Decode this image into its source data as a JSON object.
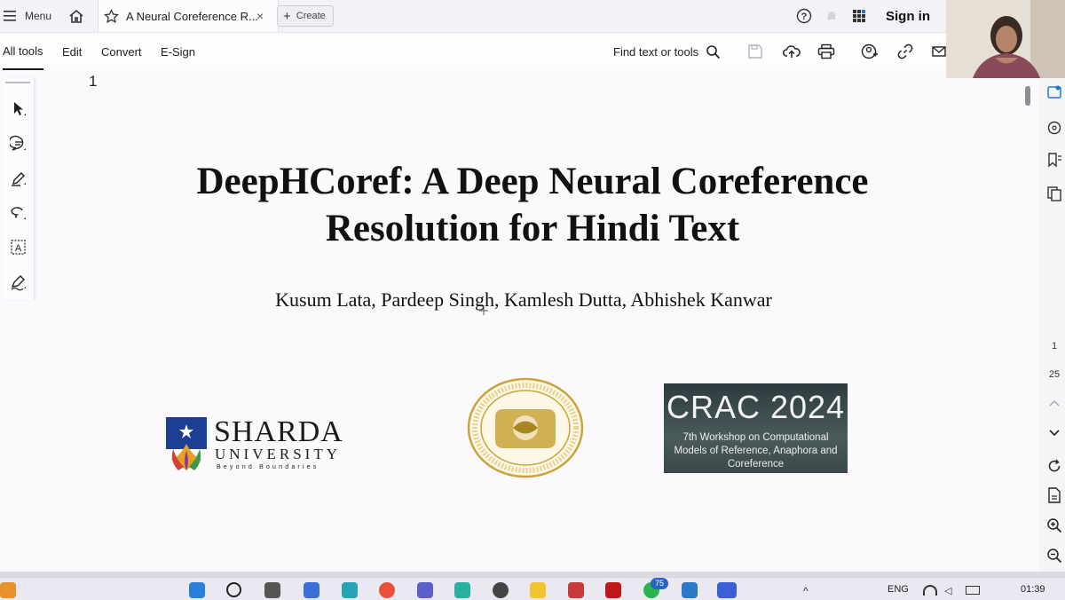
{
  "tabbar": {
    "menu_label": "Menu",
    "tab_title": "A Neural Coreference R...",
    "create_label": "Create",
    "sign_in": "Sign in"
  },
  "toolbar": {
    "all_tools": "All tools",
    "edit": "Edit",
    "convert": "Convert",
    "esign": "E-Sign",
    "find": "Find text or tools"
  },
  "document": {
    "page_number": "1",
    "title_line1": "DeepHCoref: A Deep Neural Coreference",
    "title_line2": "Resolution for Hindi Text",
    "authors": "Kusum Lata, Pardeep Singh, Kamlesh Dutta, Abhishek Kanwar",
    "logo_sharda_name": "SHARDA",
    "logo_sharda_sub": "UNIVERSITY",
    "logo_sharda_tagline": "Beyond Boundaries",
    "crac_title": "CRAC 2024",
    "crac_sub": "7th Workshop on Computational Models of Reference, Anaphora and Coreference"
  },
  "rightrail": {
    "current_page": "1",
    "total_pages": "25"
  },
  "taskbar": {
    "badge_count": "75",
    "language": "ENG",
    "time": "01:39"
  },
  "colors": {
    "accent": "#1a73e8",
    "sharda_blue": "#1c3f94",
    "gold_seal": "#c9a43a"
  }
}
